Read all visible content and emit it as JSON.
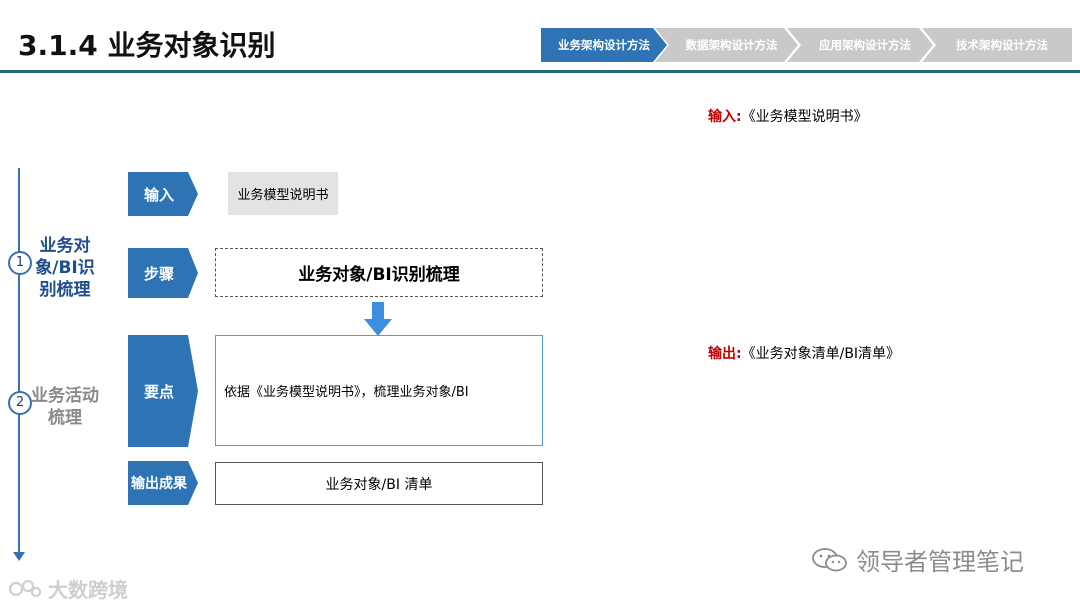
{
  "header": {
    "title": "3.1.4 业务对象识别",
    "breadcrumbs": [
      "业务架构设计方法",
      "数据架构设计方法",
      "应用架构设计方法",
      "技术架构设计方法"
    ],
    "active_index": 0
  },
  "phases": [
    {
      "number": "1",
      "label": "业务对象/BI识别梳理"
    },
    {
      "number": "2",
      "label": "业务活动梳理"
    }
  ],
  "steps": {
    "input_tag": "输入",
    "input_value": "业务模型说明书",
    "steps_tag": "步骤",
    "steps_value": "业务对象/BI识别梳理",
    "points_tag": "要点",
    "points_value": "依据《业务模型说明书》，梳理业务对象/BI",
    "output_tag": "输出成果",
    "output_value": "业务对象/BI 清单"
  },
  "notes": {
    "input_key": "输入:",
    "input_value": "《业务模型说明书》",
    "output_key": "输出:",
    "output_value": "《业务对象清单/BI清单》"
  },
  "watermarks": {
    "right": "领导者管理笔记",
    "left": "大数跨境"
  },
  "colors": {
    "accent_blue": "#2e74b5",
    "inactive_gray": "#c9c9c9",
    "title_rule": "#1f6f72",
    "key_red": "#c00000"
  }
}
